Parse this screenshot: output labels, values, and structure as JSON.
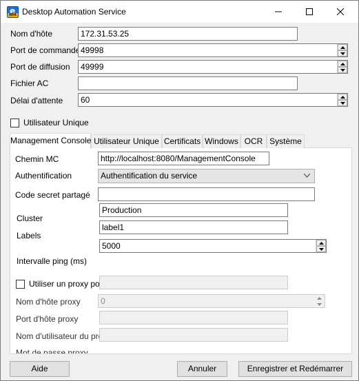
{
  "window": {
    "title": "Desktop Automation Service"
  },
  "icons": {
    "app": "desktop-automation-app-icon",
    "minimize": "minimize-icon",
    "maximize": "maximize-icon",
    "close": "close-icon"
  },
  "fields": {
    "hostname": {
      "label": "Nom d'hôte",
      "value": "172.31.53.25"
    },
    "command_port": {
      "label": "Port de commande",
      "value": "49998"
    },
    "broadcast_port": {
      "label": "Port de diffusion",
      "value": "49999"
    },
    "ca_file": {
      "label": "Fichier AC",
      "value": ""
    },
    "timeout": {
      "label": "Délai d'attente",
      "value": "60"
    }
  },
  "single_user": {
    "label": "Utilisateur Unique",
    "checked": false
  },
  "tabs": [
    {
      "label": "Management Console",
      "active": true
    },
    {
      "label": "Utilisateur Unique",
      "active": false
    },
    {
      "label": "Certificats",
      "active": false
    },
    {
      "label": "Windows",
      "active": false
    },
    {
      "label": "OCR",
      "active": false
    },
    {
      "label": "Système",
      "active": false
    }
  ],
  "mc": {
    "path": {
      "label": "Chemin MC",
      "value": "http://localhost:8080/ManagementConsole"
    },
    "auth": {
      "label": "Authentification",
      "value": "Authentification du service"
    },
    "secret": {
      "label": "Code secret partagé",
      "value": ""
    },
    "cluster": {
      "label": "Cluster",
      "value": "Production"
    },
    "labels": {
      "label": "Labels",
      "value": "label1"
    },
    "ping": {
      "label": "Intervalle ping (ms)",
      "value": "5000"
    },
    "proxy_use": {
      "label": "Utiliser un proxy pour",
      "checked": false,
      "value": ""
    },
    "proxy_host": {
      "label": "Nom d'hôte proxy",
      "value": "0"
    },
    "proxy_port": {
      "label": "Port d'hôte proxy",
      "value": ""
    },
    "proxy_user": {
      "label": "Nom d'utilisateur du proxy",
      "value": ""
    },
    "proxy_pass": {
      "label": "Mot de passe proxy"
    }
  },
  "buttons": {
    "help": "Aide",
    "cancel": "Annuler",
    "save_restart": "Enregistrer et Redémarrer"
  }
}
